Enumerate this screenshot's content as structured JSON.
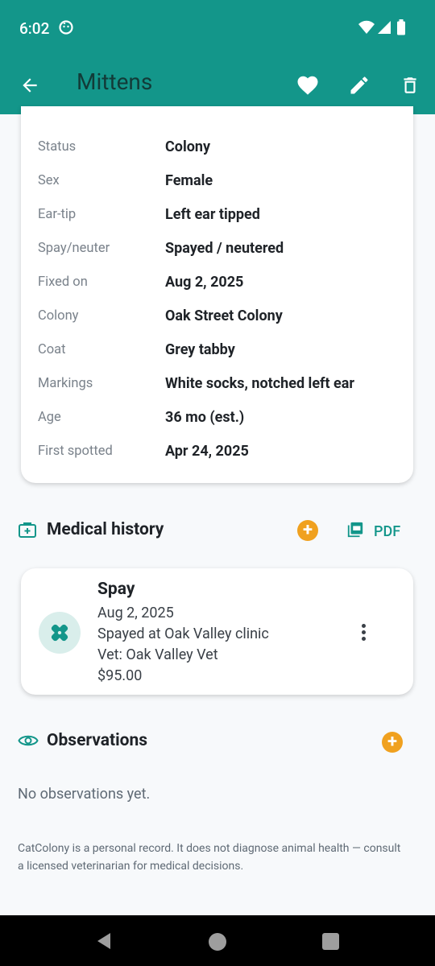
{
  "status_bar": {
    "time": "6:02"
  },
  "app_bar": {
    "title": "Mittens"
  },
  "details": [
    {
      "label": "Status",
      "value": "Colony"
    },
    {
      "label": "Sex",
      "value": "Female"
    },
    {
      "label": "Ear-tip",
      "value": "Left ear tipped"
    },
    {
      "label": "Spay/neuter",
      "value": "Spayed / neutered"
    },
    {
      "label": "Fixed on",
      "value": "Aug 2, 2025"
    },
    {
      "label": "Colony",
      "value": "Oak Street Colony"
    },
    {
      "label": "Coat",
      "value": "Grey tabby"
    },
    {
      "label": "Markings",
      "value": "White socks, notched left ear"
    },
    {
      "label": "Age",
      "value": "36 mo (est.)"
    },
    {
      "label": "First spotted",
      "value": "Apr 24, 2025"
    }
  ],
  "medical": {
    "title": "Medical history",
    "pdf_label": "PDF",
    "add_label": "+",
    "entries": [
      {
        "title": "Spay",
        "date": "Aug 2, 2025",
        "note": "Spayed at Oak Valley clinic",
        "vet": "Vet: Oak Valley Vet",
        "cost": "$95.00"
      }
    ]
  },
  "observations": {
    "title": "Observations",
    "add_label": "+",
    "empty_text": "No observations yet."
  },
  "disclaimer": "CatColony is a personal record. It does not diagnose animal health — consult a licensed veterinarian for medical decisions.",
  "colors": {
    "primary": "#13968a",
    "accent": "#f0a11f",
    "text": "#1f2328",
    "muted": "#7a828b"
  }
}
